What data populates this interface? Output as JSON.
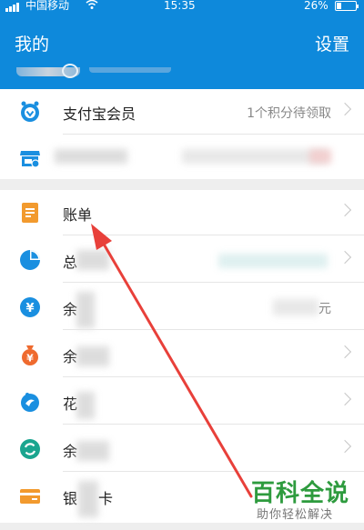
{
  "status_bar": {
    "carrier": "中国移动",
    "time": "15:35",
    "battery": "26%",
    "battery_level": 0.26
  },
  "header": {
    "title": "我的",
    "settings": "设置"
  },
  "card1": {
    "rows": [
      {
        "label": "支付宝会员",
        "hint": "1个积分待领取",
        "icon": "member-icon"
      },
      {
        "label": "",
        "hint": "",
        "icon": "shop-icon"
      }
    ]
  },
  "card2": {
    "rows": [
      {
        "label": "账单",
        "icon": "bill-icon"
      },
      {
        "label": "总",
        "icon": "pie-chart-icon"
      },
      {
        "label": "余",
        "hint": "元",
        "icon": "yuan-balance-icon"
      },
      {
        "label": "余",
        "icon": "money-bag-icon"
      },
      {
        "label": "花",
        "icon": "huabei-icon"
      },
      {
        "label": "余",
        "icon": "refresh-circle-icon"
      },
      {
        "label": "银",
        "hint": "卡",
        "icon": "bank-card-icon"
      }
    ]
  },
  "watermark": {
    "title": "百科全说",
    "subtitle": "助你轻松解决"
  },
  "colors": {
    "brand_blue": "#0e89db",
    "arrow_red": "#e8403a",
    "watermark_green": "#2e9b3e"
  }
}
